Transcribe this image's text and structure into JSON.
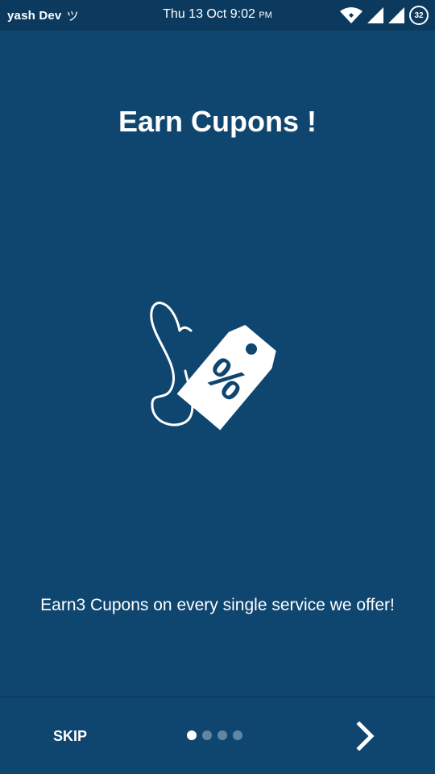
{
  "status_bar": {
    "username": "yash Dev",
    "app_symbol": "ツ",
    "datetime": "Thu 13 Oct 9:02",
    "ampm": "PM",
    "battery_level": "32"
  },
  "onboarding": {
    "title": "Earn Cupons !",
    "description": "Earn3 Cupons on every single service we offer!",
    "illustration_icon": "discount-tag-icon",
    "total_pages": 4,
    "current_page": 1
  },
  "footer": {
    "skip_label": "SKIP",
    "next_icon": "chevron-right-icon"
  },
  "colors": {
    "background": "#0f4670",
    "status_bar": "#0c3a5e",
    "text": "#ffffff"
  }
}
